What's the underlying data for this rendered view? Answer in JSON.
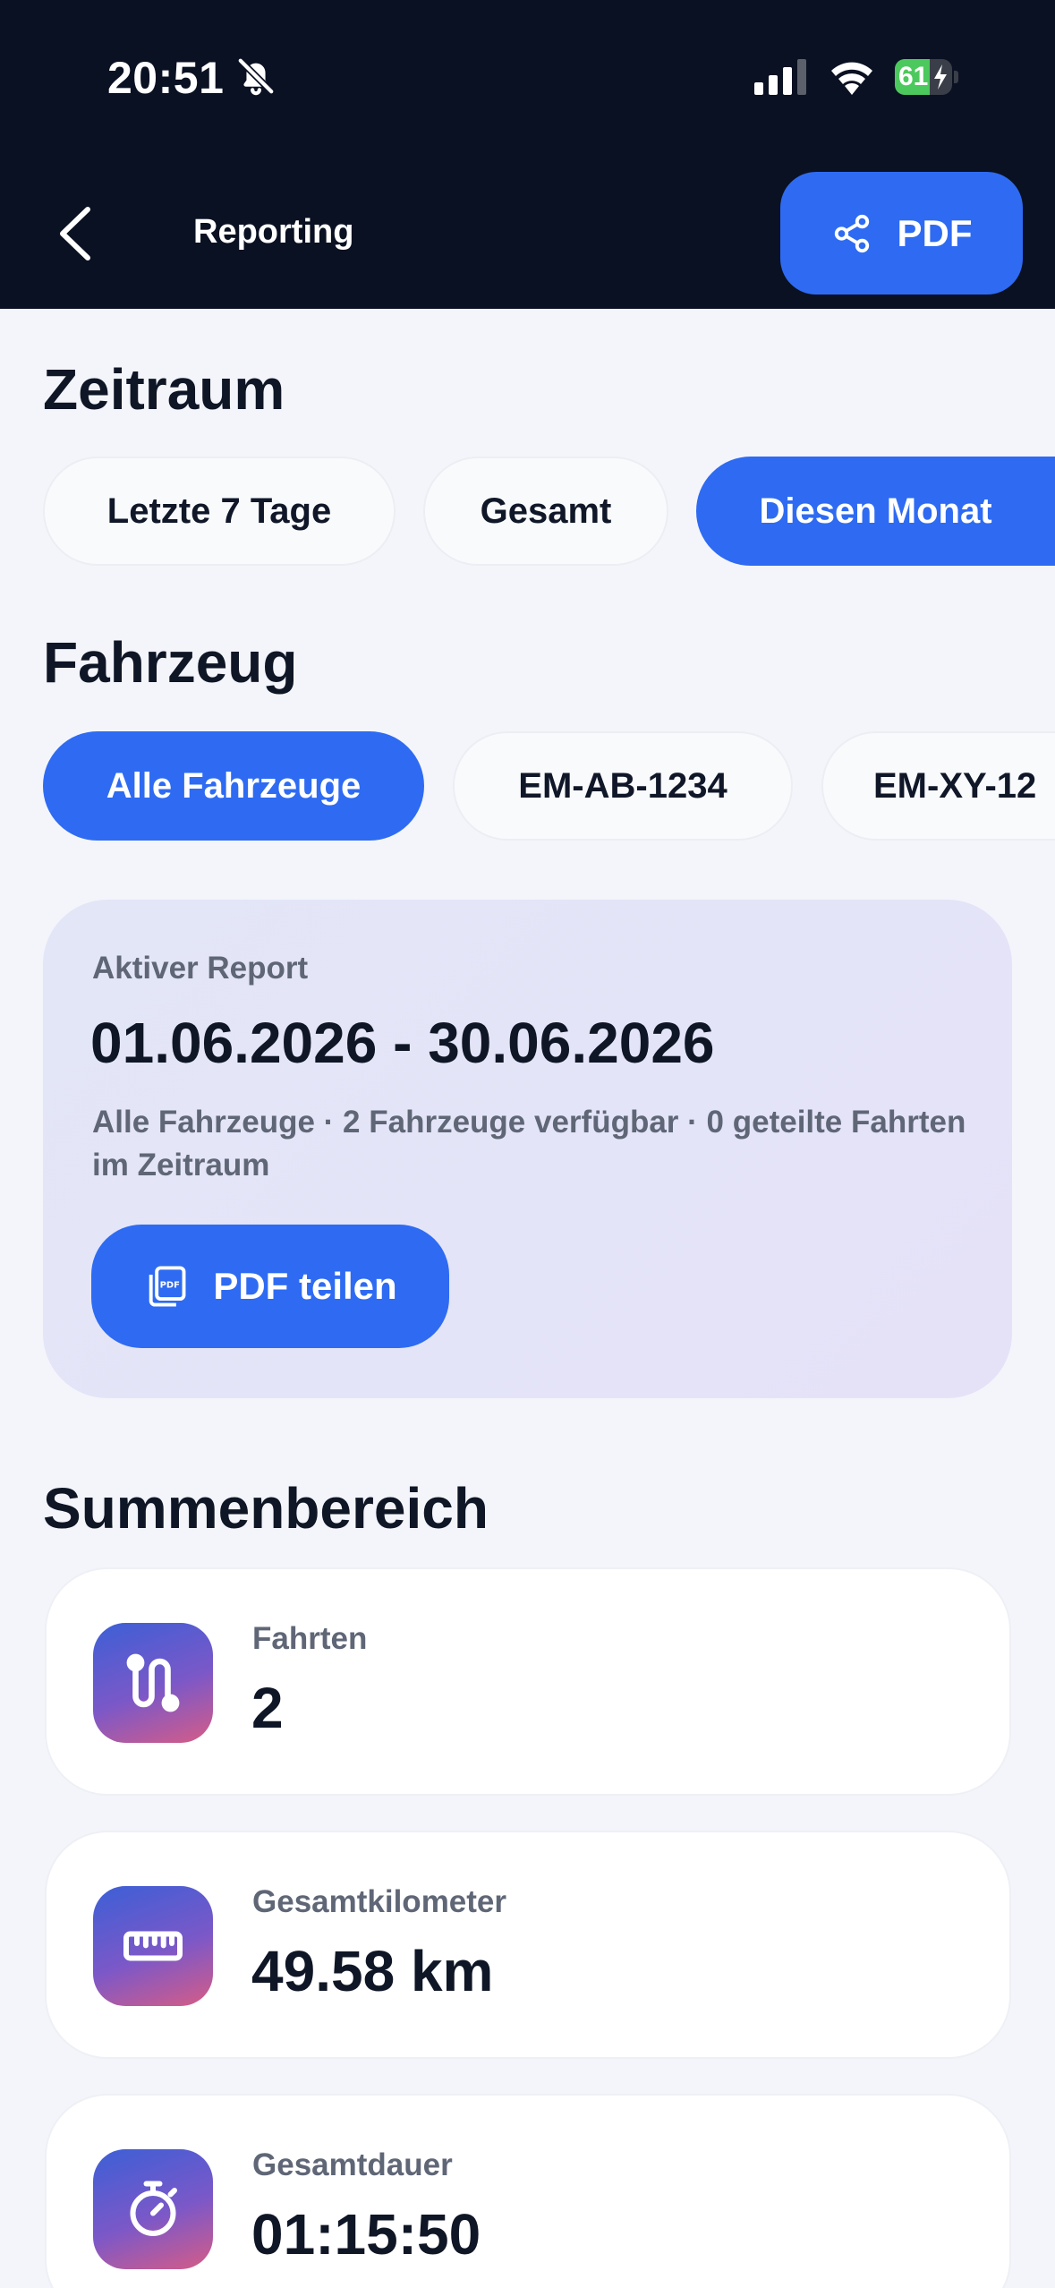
{
  "status_bar": {
    "time": "20:51",
    "battery": "61",
    "battery_level": 0.61,
    "icons": [
      "bell-slash-icon",
      "cellular-signal-icon",
      "wifi-icon",
      "battery-charging-icon"
    ]
  },
  "header": {
    "title": "Reporting",
    "pdf_button": "PDF",
    "back_icon": "chevron-left-icon",
    "pdf_icon": "share-icon"
  },
  "period": {
    "title": "Zeitraum",
    "options": [
      "Letzte 7 Tage",
      "Gesamt",
      "Diesen Monat"
    ],
    "selected": "Diesen Monat"
  },
  "vehicle": {
    "title": "Fahrzeug",
    "options": [
      "Alle Fahrzeuge",
      "EM-AB-1234",
      "EM-XY-12"
    ],
    "selected": "Alle Fahrzeuge"
  },
  "report": {
    "label": "Aktiver Report",
    "range": "01.06.2026 - 30.06.2026",
    "description": "Alle Fahrzeuge · 2 Fahrzeuge verfügbar · 0 geteilte Fahrten im Zeitraum",
    "share_button": "PDF teilen",
    "share_icon": "pdf-file-icon"
  },
  "summary": {
    "title": "Summenbereich",
    "stats": [
      {
        "label": "Fahrten",
        "value": "2",
        "icon": "route-icon"
      },
      {
        "label": "Gesamtkilometer",
        "value": "49.58 km",
        "icon": "ruler-icon"
      },
      {
        "label": "Gesamtdauer",
        "value": "01:15:50",
        "icon": "stopwatch-icon"
      }
    ]
  },
  "colors": {
    "accent": "#2e6bf2",
    "header_bg": "#0a1122",
    "page_bg": "#f4f5fa",
    "battery_green": "#4cc95c"
  }
}
